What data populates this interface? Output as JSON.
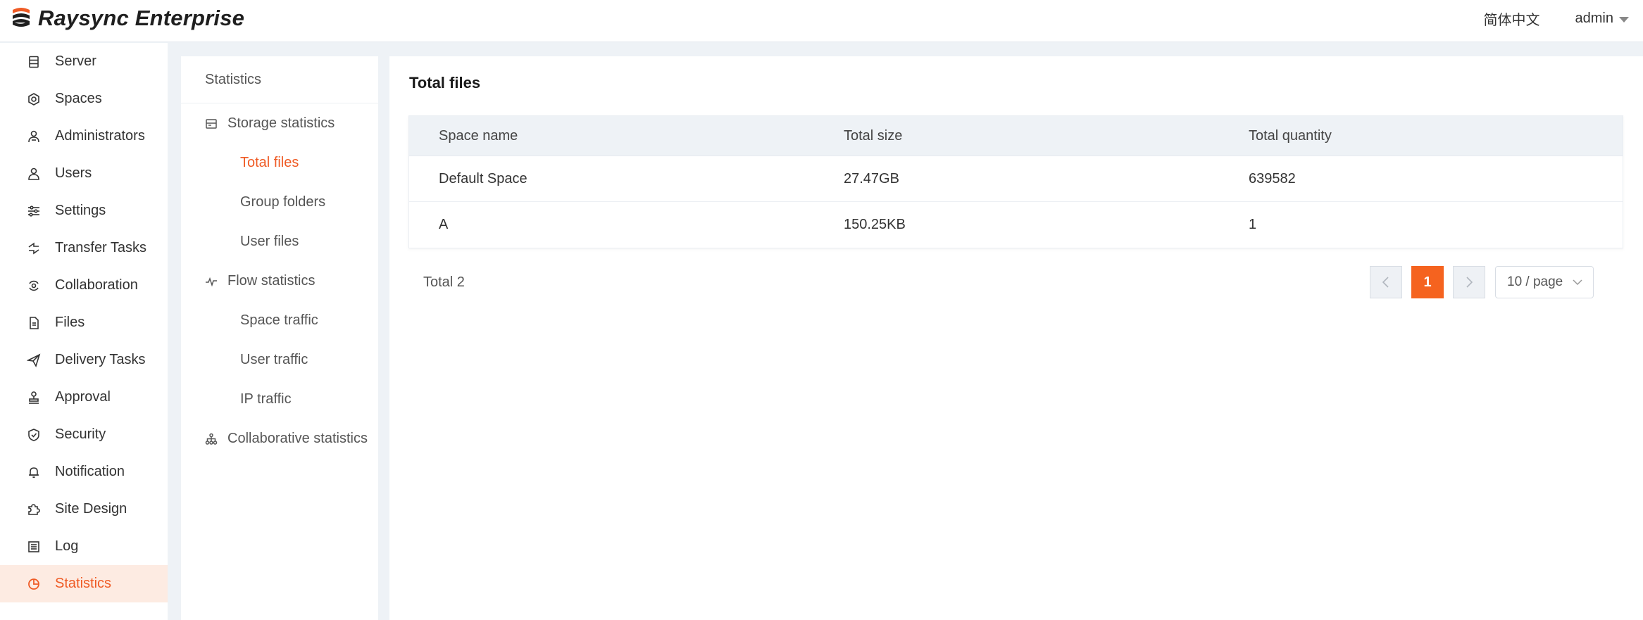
{
  "app": {
    "brand": "Raysync Enterprise",
    "language": "简体中文",
    "user": "admin",
    "accent_color": "#ef5b25"
  },
  "sidebar": {
    "items": [
      {
        "label": "Server",
        "icon": "server-icon"
      },
      {
        "label": "Spaces",
        "icon": "spaces-icon"
      },
      {
        "label": "Administrators",
        "icon": "administrators-icon"
      },
      {
        "label": "Users",
        "icon": "user-icon"
      },
      {
        "label": "Settings",
        "icon": "sliders-icon"
      },
      {
        "label": "Transfer Tasks",
        "icon": "transfer-icon"
      },
      {
        "label": "Collaboration",
        "icon": "collaboration-icon"
      },
      {
        "label": "Files",
        "icon": "file-icon"
      },
      {
        "label": "Delivery Tasks",
        "icon": "paper-plane-icon"
      },
      {
        "label": "Approval",
        "icon": "stamp-icon"
      },
      {
        "label": "Security",
        "icon": "shield-icon"
      },
      {
        "label": "Notification",
        "icon": "bell-icon"
      },
      {
        "label": "Site Design",
        "icon": "puzzle-icon"
      },
      {
        "label": "Log",
        "icon": "log-icon"
      },
      {
        "label": "Statistics",
        "icon": "pie-chart-icon",
        "active": true
      }
    ]
  },
  "submenu": {
    "title": "Statistics",
    "storage": {
      "label": "Storage statistics",
      "items": [
        "Total files",
        "Group folders",
        "User files"
      ]
    },
    "flow": {
      "label": "Flow statistics",
      "items": [
        "Space traffic",
        "User traffic",
        "IP traffic"
      ]
    },
    "collab": {
      "label": "Collaborative statistics"
    }
  },
  "main": {
    "title": "Total files",
    "columns": [
      "Space name",
      "Total size",
      "Total quantity"
    ],
    "rows": [
      [
        "Default Space",
        "27.47GB",
        "639582"
      ],
      [
        "A",
        "150.25KB",
        "1"
      ]
    ],
    "total_label": "Total 2",
    "pagination": {
      "current_page": "1",
      "page_size": "10 / page"
    }
  }
}
